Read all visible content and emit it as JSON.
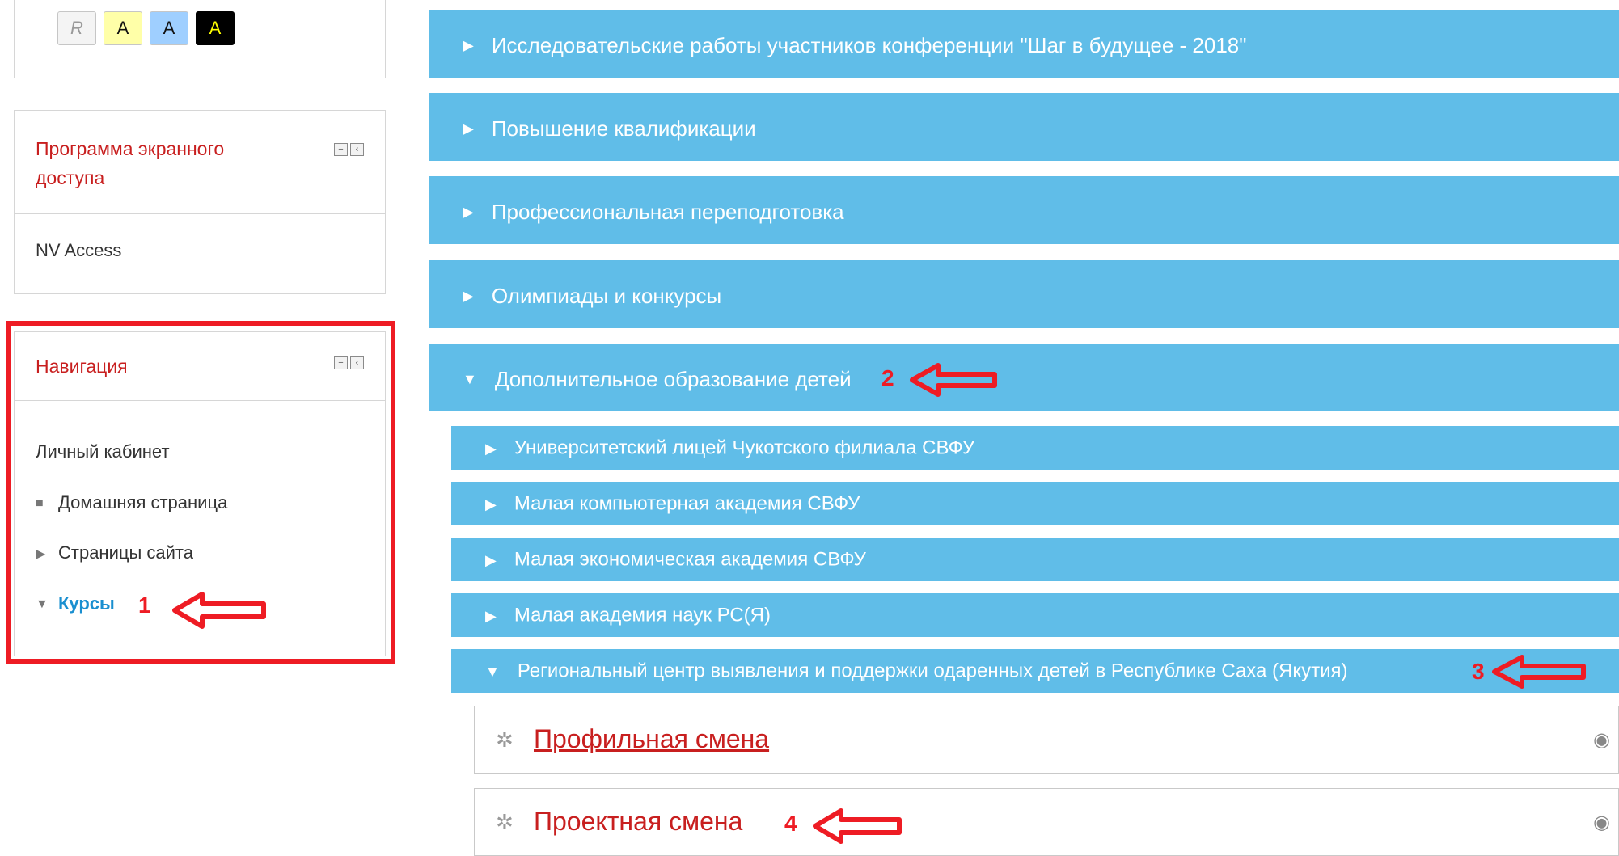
{
  "accessibility": {
    "buttons": [
      {
        "label": "R"
      },
      {
        "label": "A"
      },
      {
        "label": "A"
      },
      {
        "label": "A"
      }
    ]
  },
  "screen_reader_block": {
    "title": "Программа экранного доступа",
    "link": "NV Access"
  },
  "navigation_block": {
    "title": "Навигация",
    "items": [
      {
        "label": "Личный кабинет"
      },
      {
        "label": "Домашняя страница",
        "icon": "square-bullet"
      },
      {
        "label": "Страницы сайта",
        "icon": "triangle-right"
      },
      {
        "label": "Курсы",
        "icon": "triangle-down"
      }
    ]
  },
  "categories": [
    {
      "label": "Исследовательские работы участников конференции \"Шаг в будущее - 2018\"",
      "expanded": false
    },
    {
      "label": "Повышение квалификации",
      "expanded": false
    },
    {
      "label": "Профессиональная переподготовка",
      "expanded": false
    },
    {
      "label": "Олимпиады и конкурсы",
      "expanded": false
    },
    {
      "label": "Дополнительное образование детей",
      "expanded": true
    }
  ],
  "subcategories": [
    {
      "label": "Университетский лицей Чукотского филиала СВФУ",
      "expanded": false
    },
    {
      "label": "Малая компьютерная академия СВФУ",
      "expanded": false
    },
    {
      "label": "Малая экономическая академия СВФУ",
      "expanded": false
    },
    {
      "label": "Малая академия наук РС(Я)",
      "expanded": false
    },
    {
      "label": "Региональный центр выявления и поддержки одаренных детей в Республике Саха (Якутия)",
      "expanded": true
    }
  ],
  "courses": [
    {
      "title": "Профильная смена"
    },
    {
      "title": "Проектная смена"
    }
  ],
  "annotations": [
    "1",
    "2",
    "3",
    "4"
  ],
  "colors": {
    "category_bg": "#60bde8",
    "annotation_red": "#ee1c24",
    "block_title_red": "#c81f1f",
    "link_blue": "#1a8fd0"
  }
}
